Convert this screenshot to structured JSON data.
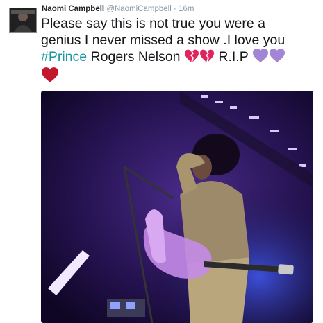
{
  "tweet": {
    "author_name": "Naomi Campbell",
    "author_handle": "@NaomiCampbell",
    "separator": "·",
    "timestamp": "16m",
    "avatar_label": "Naomi Campbell",
    "text_line1": "Please say this is not true you were a",
    "text_line2": "genius I never missed a show .I love you",
    "hashtag": "#Prince",
    "text_after_hashtag": " Rogers Nelson ",
    "rip_text": " R.I.P ",
    "emojis": [
      "broken-heart-icon",
      "broken-heart-icon",
      "purple-heart-icon",
      "purple-heart-icon",
      "red-heart-icon"
    ]
  },
  "photo": {
    "description_icon": "concert-photo",
    "colors": {
      "background": "#1b0d3a",
      "stage_light": "#b07ad6",
      "guitar": "#c58be8"
    }
  },
  "colors": {
    "hashtag": "#1b95a0",
    "text": "#14171a",
    "meta": "#8899a6",
    "broken_heart": "#e0245e",
    "purple_heart": "#a385d6",
    "red_heart": "#c3182b"
  }
}
